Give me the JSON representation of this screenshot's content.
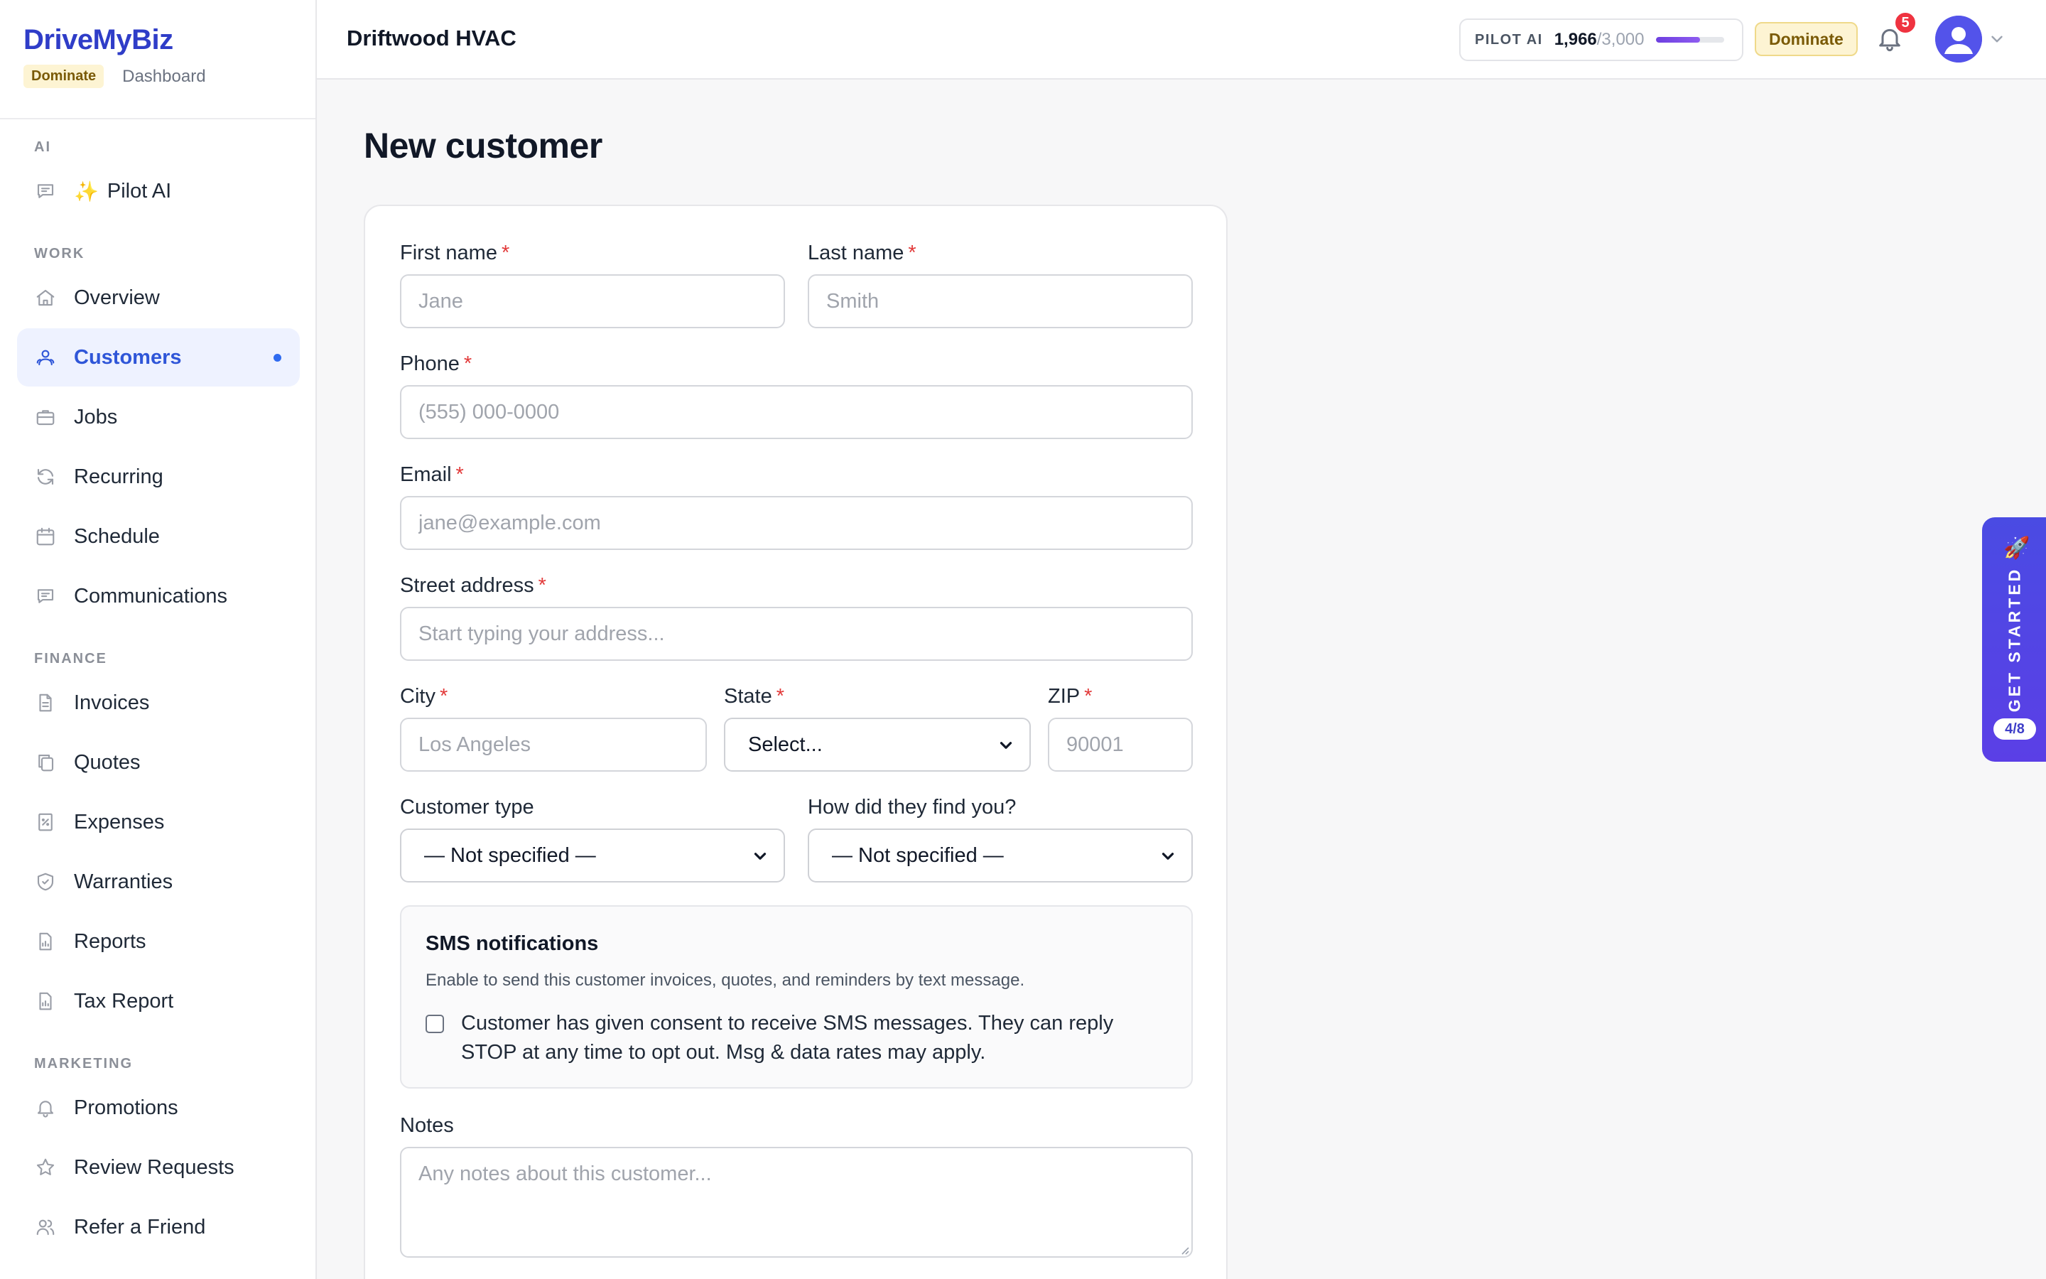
{
  "brand": {
    "name": "DriveMyBiz",
    "plan": "Dominate",
    "subtitle": "Dashboard"
  },
  "sidebar": {
    "sections": [
      {
        "label": "AI",
        "items": [
          {
            "label": "Pilot AI",
            "icon": "chat-bubble-icon",
            "sparkle": "✨"
          }
        ]
      },
      {
        "label": "WORK",
        "items": [
          {
            "label": "Overview",
            "icon": "home-icon"
          },
          {
            "label": "Customers",
            "icon": "users-icon",
            "active": true
          },
          {
            "label": "Jobs",
            "icon": "briefcase-icon"
          },
          {
            "label": "Recurring",
            "icon": "refresh-icon"
          },
          {
            "label": "Schedule",
            "icon": "calendar-icon"
          },
          {
            "label": "Communications",
            "icon": "message-icon"
          }
        ]
      },
      {
        "label": "FINANCE",
        "items": [
          {
            "label": "Invoices",
            "icon": "document-icon"
          },
          {
            "label": "Quotes",
            "icon": "copy-icon"
          },
          {
            "label": "Expenses",
            "icon": "receipt-icon"
          },
          {
            "label": "Warranties",
            "icon": "shield-icon"
          },
          {
            "label": "Reports",
            "icon": "bar-chart-icon"
          },
          {
            "label": "Tax Report",
            "icon": "file-chart-icon"
          }
        ]
      },
      {
        "label": "MARKETING",
        "items": [
          {
            "label": "Promotions",
            "icon": "bell-icon"
          },
          {
            "label": "Review Requests",
            "icon": "star-icon"
          },
          {
            "label": "Refer a Friend",
            "icon": "user-group-icon"
          }
        ]
      }
    ]
  },
  "header": {
    "company": "Driftwood HVAC",
    "usage": {
      "label": "PILOT AI",
      "used": "1,966",
      "max": "/3,000",
      "fraction": 0.655
    },
    "plan_badge": "Dominate",
    "notifications": "5"
  },
  "page": {
    "title": "New customer"
  },
  "form": {
    "first_name": {
      "label": "First name",
      "placeholder": "Jane"
    },
    "last_name": {
      "label": "Last name",
      "placeholder": "Smith"
    },
    "phone": {
      "label": "Phone",
      "placeholder": "(555) 000-0000"
    },
    "email": {
      "label": "Email",
      "placeholder": "jane@example.com"
    },
    "street": {
      "label": "Street address",
      "placeholder": "Start typing your address..."
    },
    "city": {
      "label": "City",
      "placeholder": "Los Angeles"
    },
    "state": {
      "label": "State",
      "value": "Select..."
    },
    "zip": {
      "label": "ZIP",
      "placeholder": "90001"
    },
    "customer_type": {
      "label": "Customer type",
      "value": "— Not specified —"
    },
    "source": {
      "label": "How did they find you?",
      "value": "— Not specified —"
    },
    "sms": {
      "title": "SMS notifications",
      "description": "Enable to send this customer invoices, quotes, and reminders by text message.",
      "consent": "Customer has given consent to receive SMS messages. They can reply STOP at any time to opt out. Msg & data rates may apply."
    },
    "notes": {
      "label": "Notes",
      "placeholder": "Any notes about this customer..."
    },
    "required_mark": "*"
  },
  "get_started": {
    "label": "GET STARTED",
    "progress": "4/8",
    "icon": "🚀"
  },
  "colors": {
    "brand": "#2f3dc8",
    "accent": "#2f56d8",
    "required": "#e23a3a",
    "tab": "#4a4be3"
  }
}
